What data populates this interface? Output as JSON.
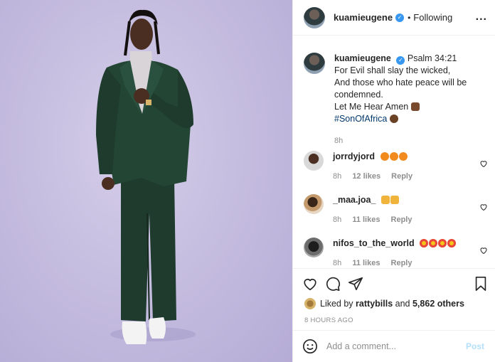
{
  "header": {
    "username": "kuamieugene",
    "separator": "•",
    "follow_status": "Following",
    "more_icon": "..."
  },
  "caption": {
    "username": "kuamieugene",
    "first_line": "Psalm 34:21",
    "lines": [
      "For Evil shall slay the wicked,",
      "And those who hate peace will be condemned.",
      "Let Me Hear Amen"
    ],
    "hashtag": "#SonOfAfrica",
    "time": "8h"
  },
  "comments": [
    {
      "username": "jorrdyjord",
      "emoji": [
        "fire",
        "fire",
        "fire"
      ],
      "time": "8h",
      "likes": "12 likes",
      "reply": "Reply"
    },
    {
      "username": "_maa.joa_",
      "emoji": [
        "praying",
        "praying"
      ],
      "time": "8h",
      "likes": "11 likes",
      "reply": "Reply"
    },
    {
      "username": "nifos_to_the_world",
      "emoji": [
        "heart-eyes",
        "heart-eyes",
        "heart-eyes",
        "heart-eyes"
      ],
      "time": "8h",
      "likes": "11 likes",
      "reply": "Reply"
    }
  ],
  "actions": {
    "liked_prefix": "Liked by",
    "liked_user": "rattybills",
    "liked_and": "and",
    "liked_others": "5,862 others",
    "time_ago": "8 HOURS AGO"
  },
  "add_comment": {
    "placeholder": "Add a comment...",
    "post_label": "Post"
  },
  "colors": {
    "accent": "#3897f0",
    "hashtag": "#00376b",
    "muted": "#8e8e8e",
    "post_disabled": "#b2dffc",
    "photo_bg": "#c6bee0",
    "suit": "#1f3b2e"
  }
}
